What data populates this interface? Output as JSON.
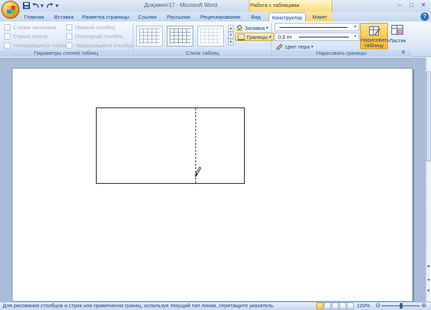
{
  "window": {
    "title": "Документ17 - Microsoft Word",
    "contextual_group": "Работа с таблицами"
  },
  "quick_access": {
    "icons": [
      "save-icon",
      "undo-icon",
      "redo-icon",
      "customize-icon"
    ]
  },
  "tabs": [
    {
      "label": "Главная",
      "active": false
    },
    {
      "label": "Вставка",
      "active": false
    },
    {
      "label": "Разметка страницы",
      "active": false
    },
    {
      "label": "Ссылки",
      "active": false
    },
    {
      "label": "Рассылки",
      "active": false
    },
    {
      "label": "Рецензирование",
      "active": false
    },
    {
      "label": "Вид",
      "active": false
    },
    {
      "label": "Конструктор",
      "active": true
    },
    {
      "label": "Макет",
      "active": false
    }
  ],
  "ribbon": {
    "table_style_options": {
      "label": "Параметры стилей таблиц",
      "checkboxes": [
        "Строка заголовка",
        "Строка итогов",
        "Чередующиеся строки",
        "Первый столбец",
        "Последний столбец",
        "Чередующиеся столбцы"
      ]
    },
    "table_styles": {
      "label": "Стили таблиц",
      "shading_label": "Заливка",
      "borders_label": "Границы"
    },
    "draw_borders": {
      "label": "Нарисовать границы",
      "line_weight": "0,5 пт",
      "pen_color_label": "Цвет пера",
      "draw_table_label_1": "Нарисовать",
      "draw_table_label_2": "таблицу",
      "eraser_label": "Ластик"
    }
  },
  "status_bar": {
    "text": "Для рисования столбцов и строк или применения границ, используя текущий тип линии, перетащите указатель.",
    "zoom": "120%"
  },
  "colors": {
    "accent": "#15428b",
    "ribbon_bg": "#dbe7f6",
    "contextual": "#f8dc7e",
    "active_button": "#ffc850"
  }
}
